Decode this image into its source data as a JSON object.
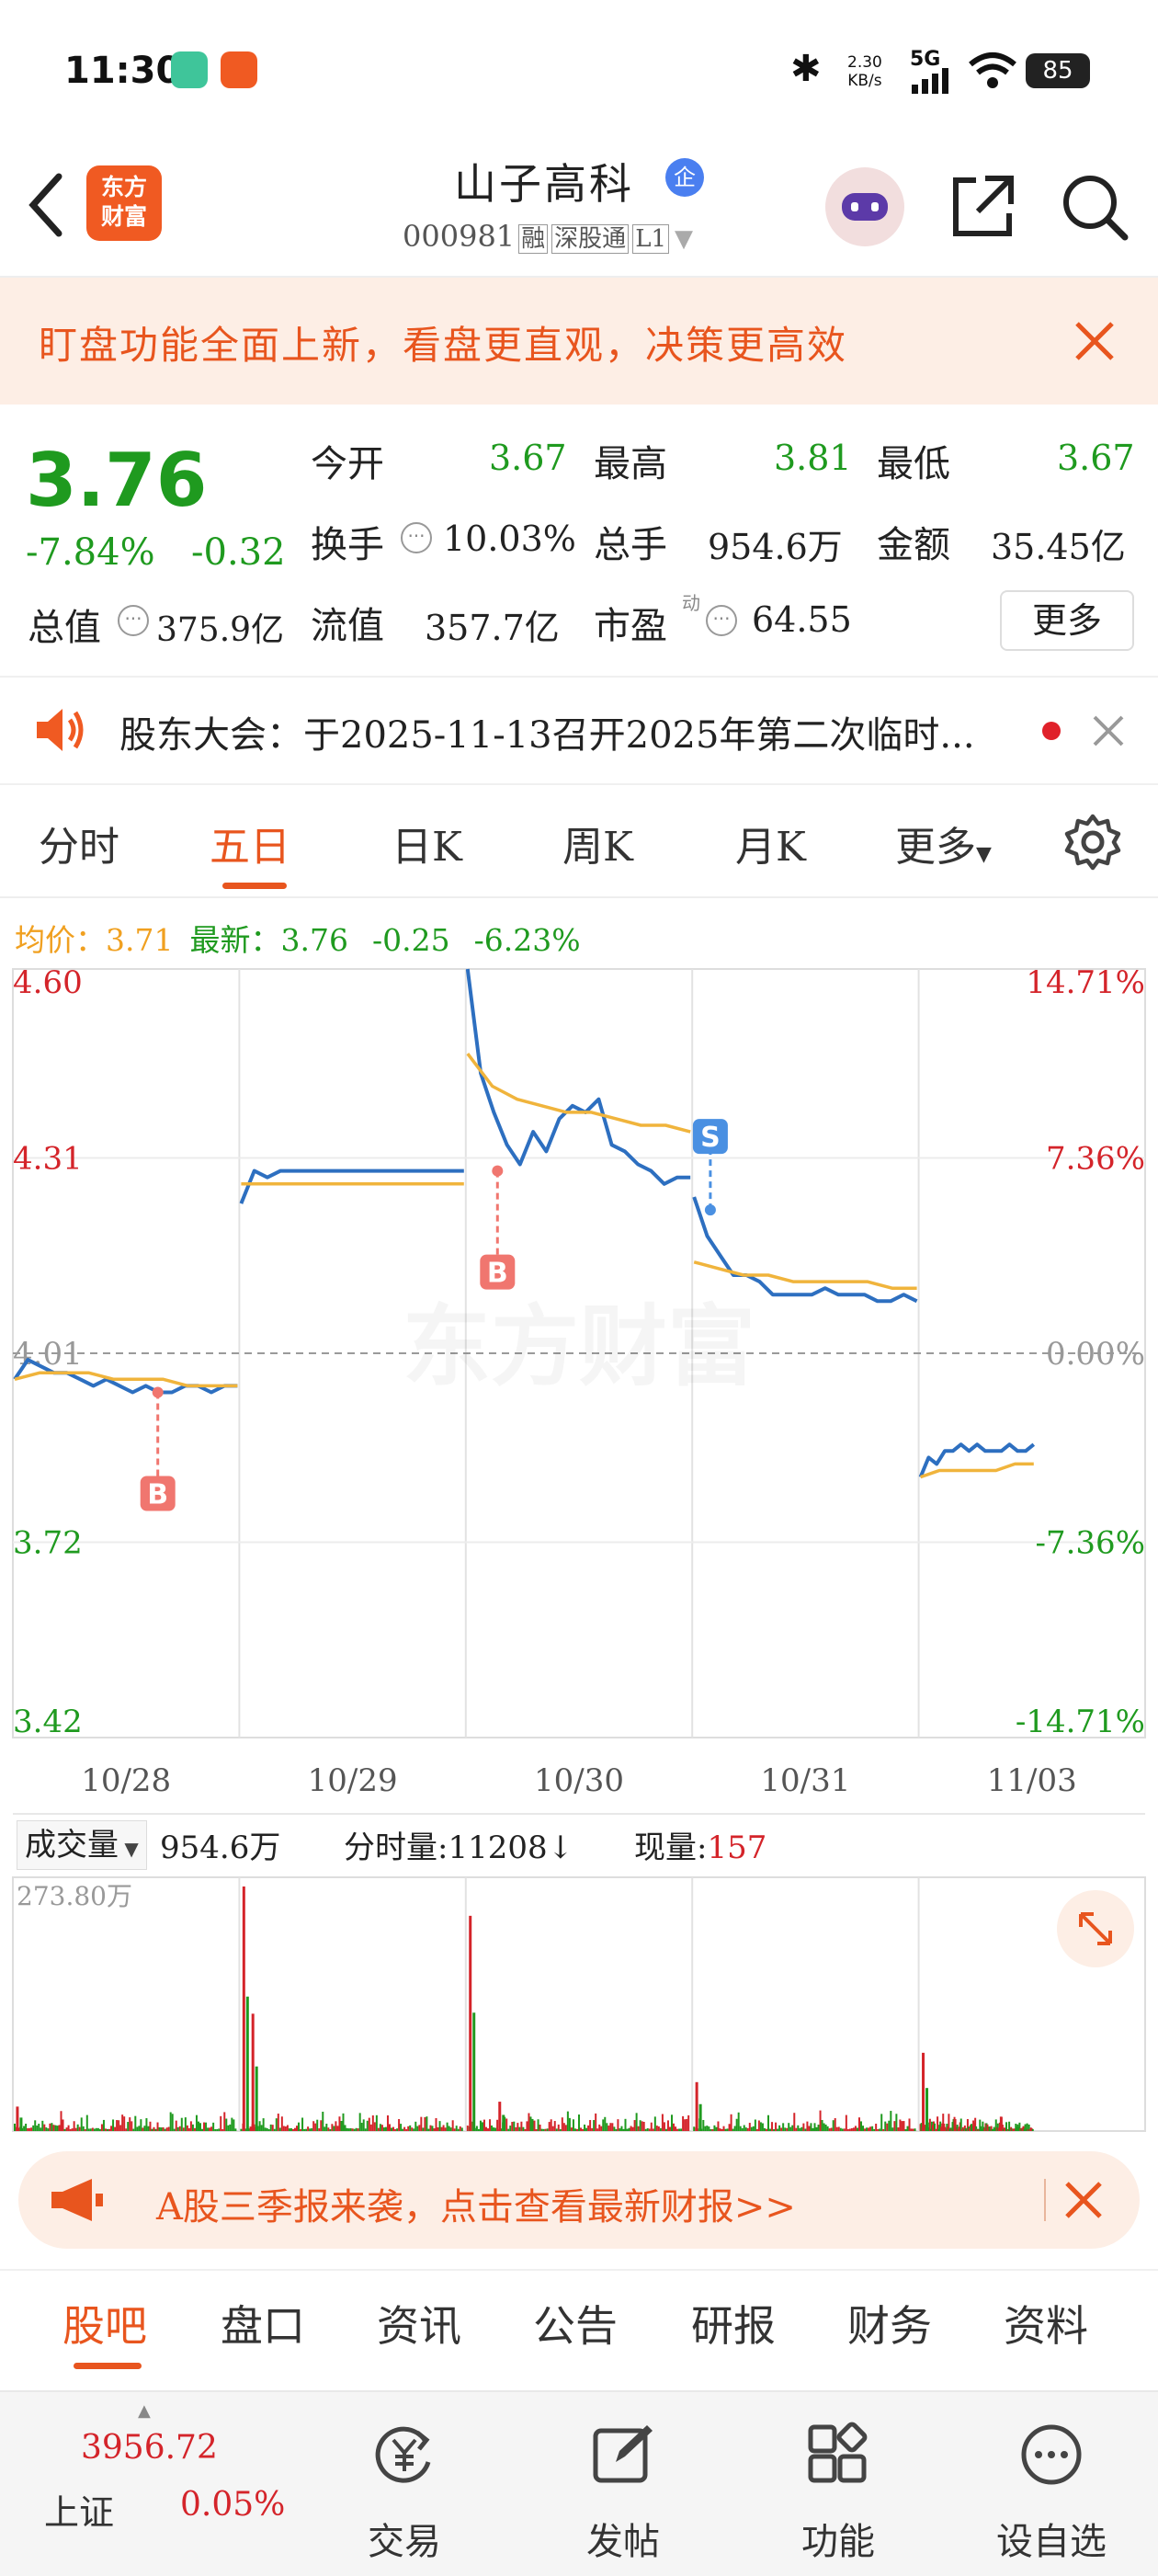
{
  "status": {
    "time": "11:30",
    "net_speed_value": "2.30",
    "net_speed_unit": "KB/s",
    "network": "5G",
    "battery": "85"
  },
  "header": {
    "logo_line1": "东方",
    "logo_line2": "财富",
    "stock_name": "山子高科",
    "badge": "企",
    "code": "000981",
    "tag1": "融",
    "tag2": "深股通",
    "tag3": "L1"
  },
  "banner": {
    "text": "盯盘功能全面上新，看盘更直观，决策更高效"
  },
  "quote": {
    "price": "3.76",
    "change_pct": "-7.84%",
    "change": "-0.32",
    "open_label": "今开",
    "open": "3.67",
    "high_label": "最高",
    "high": "3.81",
    "low_label": "最低",
    "low": "3.67",
    "turnover_label": "换手",
    "turnover": "10.03%",
    "volume_label": "总手",
    "volume": "954.6万",
    "amount_label": "金额",
    "amount": "35.45亿",
    "mcap_label": "总值",
    "mcap": "375.9亿",
    "float_label": "流值",
    "float": "357.7亿",
    "pe_label": "市盈",
    "pe_sup": "动",
    "pe": "64.55",
    "more": "更多"
  },
  "notice": {
    "text": "股东大会：于2025-11-13召开2025年第二次临时..."
  },
  "tabs": [
    "分时",
    "五日",
    "日K",
    "周K",
    "月K",
    "更多"
  ],
  "chart_info": {
    "avg_label": "均价：",
    "avg": "3.71",
    "latest_label": "最新：",
    "latest": "3.76",
    "chg": "-0.25",
    "chg_pct": "-6.23%"
  },
  "chart_data": [
    {
      "type": "line",
      "title": "",
      "x_labels": [
        "10/28",
        "10/29",
        "10/30",
        "10/31",
        "11/03"
      ],
      "y_left_ticks": [
        "4.60",
        "4.31",
        "4.01",
        "3.72",
        "3.42"
      ],
      "y_right_ticks": [
        "14.71%",
        "7.36%",
        "0.00%",
        "-7.36%",
        "-14.71%"
      ],
      "ylim": [
        3.42,
        4.6
      ],
      "prev_close": 4.01,
      "watermark": "东方财富",
      "series": [
        {
          "name": "",
          "color": "#2d6fc0",
          "days": [
            [
              3.97,
              4.0,
              3.99,
              3.98,
              3.98,
              3.97,
              3.96,
              3.97,
              3.96,
              3.95,
              3.96,
              3.95,
              3.95,
              3.96,
              3.96,
              3.95,
              3.96,
              3.96
            ],
            [
              4.24,
              4.29,
              4.28,
              4.29,
              4.29,
              4.29,
              4.29,
              4.29,
              4.29,
              4.29,
              4.29,
              4.29,
              4.29,
              4.29,
              4.29,
              4.29,
              4.29,
              4.29
            ],
            [
              4.6,
              4.44,
              4.38,
              4.33,
              4.3,
              4.35,
              4.32,
              4.37,
              4.39,
              4.38,
              4.4,
              4.33,
              4.32,
              4.3,
              4.29,
              4.27,
              4.28,
              4.28
            ],
            [
              4.25,
              4.19,
              4.16,
              4.13,
              4.13,
              4.12,
              4.1,
              4.1,
              4.1,
              4.1,
              4.11,
              4.1,
              4.1,
              4.1,
              4.09,
              4.09,
              4.1,
              4.09
            ],
            [
              3.82,
              3.85,
              3.84,
              3.86,
              3.86,
              3.87,
              3.86,
              3.87,
              3.86,
              3.86,
              3.86,
              3.87,
              3.86,
              3.86,
              3.87
            ]
          ]
        },
        {
          "name": "",
          "color": "#f0b43c",
          "days": [
            [
              3.97,
              3.98,
              3.98,
              3.98,
              3.97,
              3.97,
              3.97,
              3.96,
              3.96,
              3.96
            ],
            [
              4.27,
              4.27,
              4.27,
              4.27,
              4.27,
              4.27,
              4.27,
              4.27,
              4.27,
              4.27
            ],
            [
              4.47,
              4.42,
              4.4,
              4.39,
              4.38,
              4.38,
              4.37,
              4.36,
              4.36,
              4.35
            ],
            [
              4.15,
              4.14,
              4.13,
              4.13,
              4.12,
              4.12,
              4.12,
              4.12,
              4.11,
              4.11
            ],
            [
              3.82,
              3.83,
              3.83,
              3.83,
              3.83,
              3.84,
              3.84
            ]
          ]
        }
      ],
      "markers": [
        {
          "label": "B",
          "day": 0,
          "pos": 0.64,
          "price": 3.95
        },
        {
          "label": "B",
          "day": 2,
          "pos": 0.14,
          "price": 4.29
        },
        {
          "label": "S",
          "day": 3,
          "pos": 0.08,
          "price": 4.23
        }
      ]
    },
    {
      "type": "bar",
      "title": "",
      "max_label": "273.80万",
      "spikes": [
        {
          "day": 1,
          "pos": 0.02,
          "v": 1.0
        },
        {
          "day": 1,
          "pos": 0.06,
          "v": 0.48
        },
        {
          "day": 2,
          "pos": 0.02,
          "v": 0.88
        },
        {
          "day": 3,
          "pos": 0.02,
          "v": 0.2
        },
        {
          "day": 4,
          "pos": 0.02,
          "v": 0.32
        },
        {
          "day": 0,
          "pos": 0.02,
          "v": 0.1
        },
        {
          "day": 2,
          "pos": 0.15,
          "v": 0.12
        }
      ]
    }
  ],
  "volume_bar": {
    "select": "成交量",
    "total": "954.6万",
    "tick_label": "分时量:",
    "tick": "11208",
    "arrow": "↓",
    "now_label": "现量:",
    "now": "157"
  },
  "promo": {
    "text": "A股三季报来袭，点击查看最新财报>>"
  },
  "subtabs": [
    "股吧",
    "盘口",
    "资讯",
    "公告",
    "研报",
    "财务",
    "资料"
  ],
  "bottom": {
    "index_value": "3956.72",
    "index_name": "上证",
    "index_pct": "0.05%",
    "items": [
      "交易",
      "发帖",
      "功能",
      "设自选"
    ]
  },
  "colors": {
    "accent": "#e8551e",
    "up": "#d4242a",
    "down": "#1f9a1f",
    "price_line": "#2d6fc0",
    "avg_line": "#f0b43c"
  }
}
